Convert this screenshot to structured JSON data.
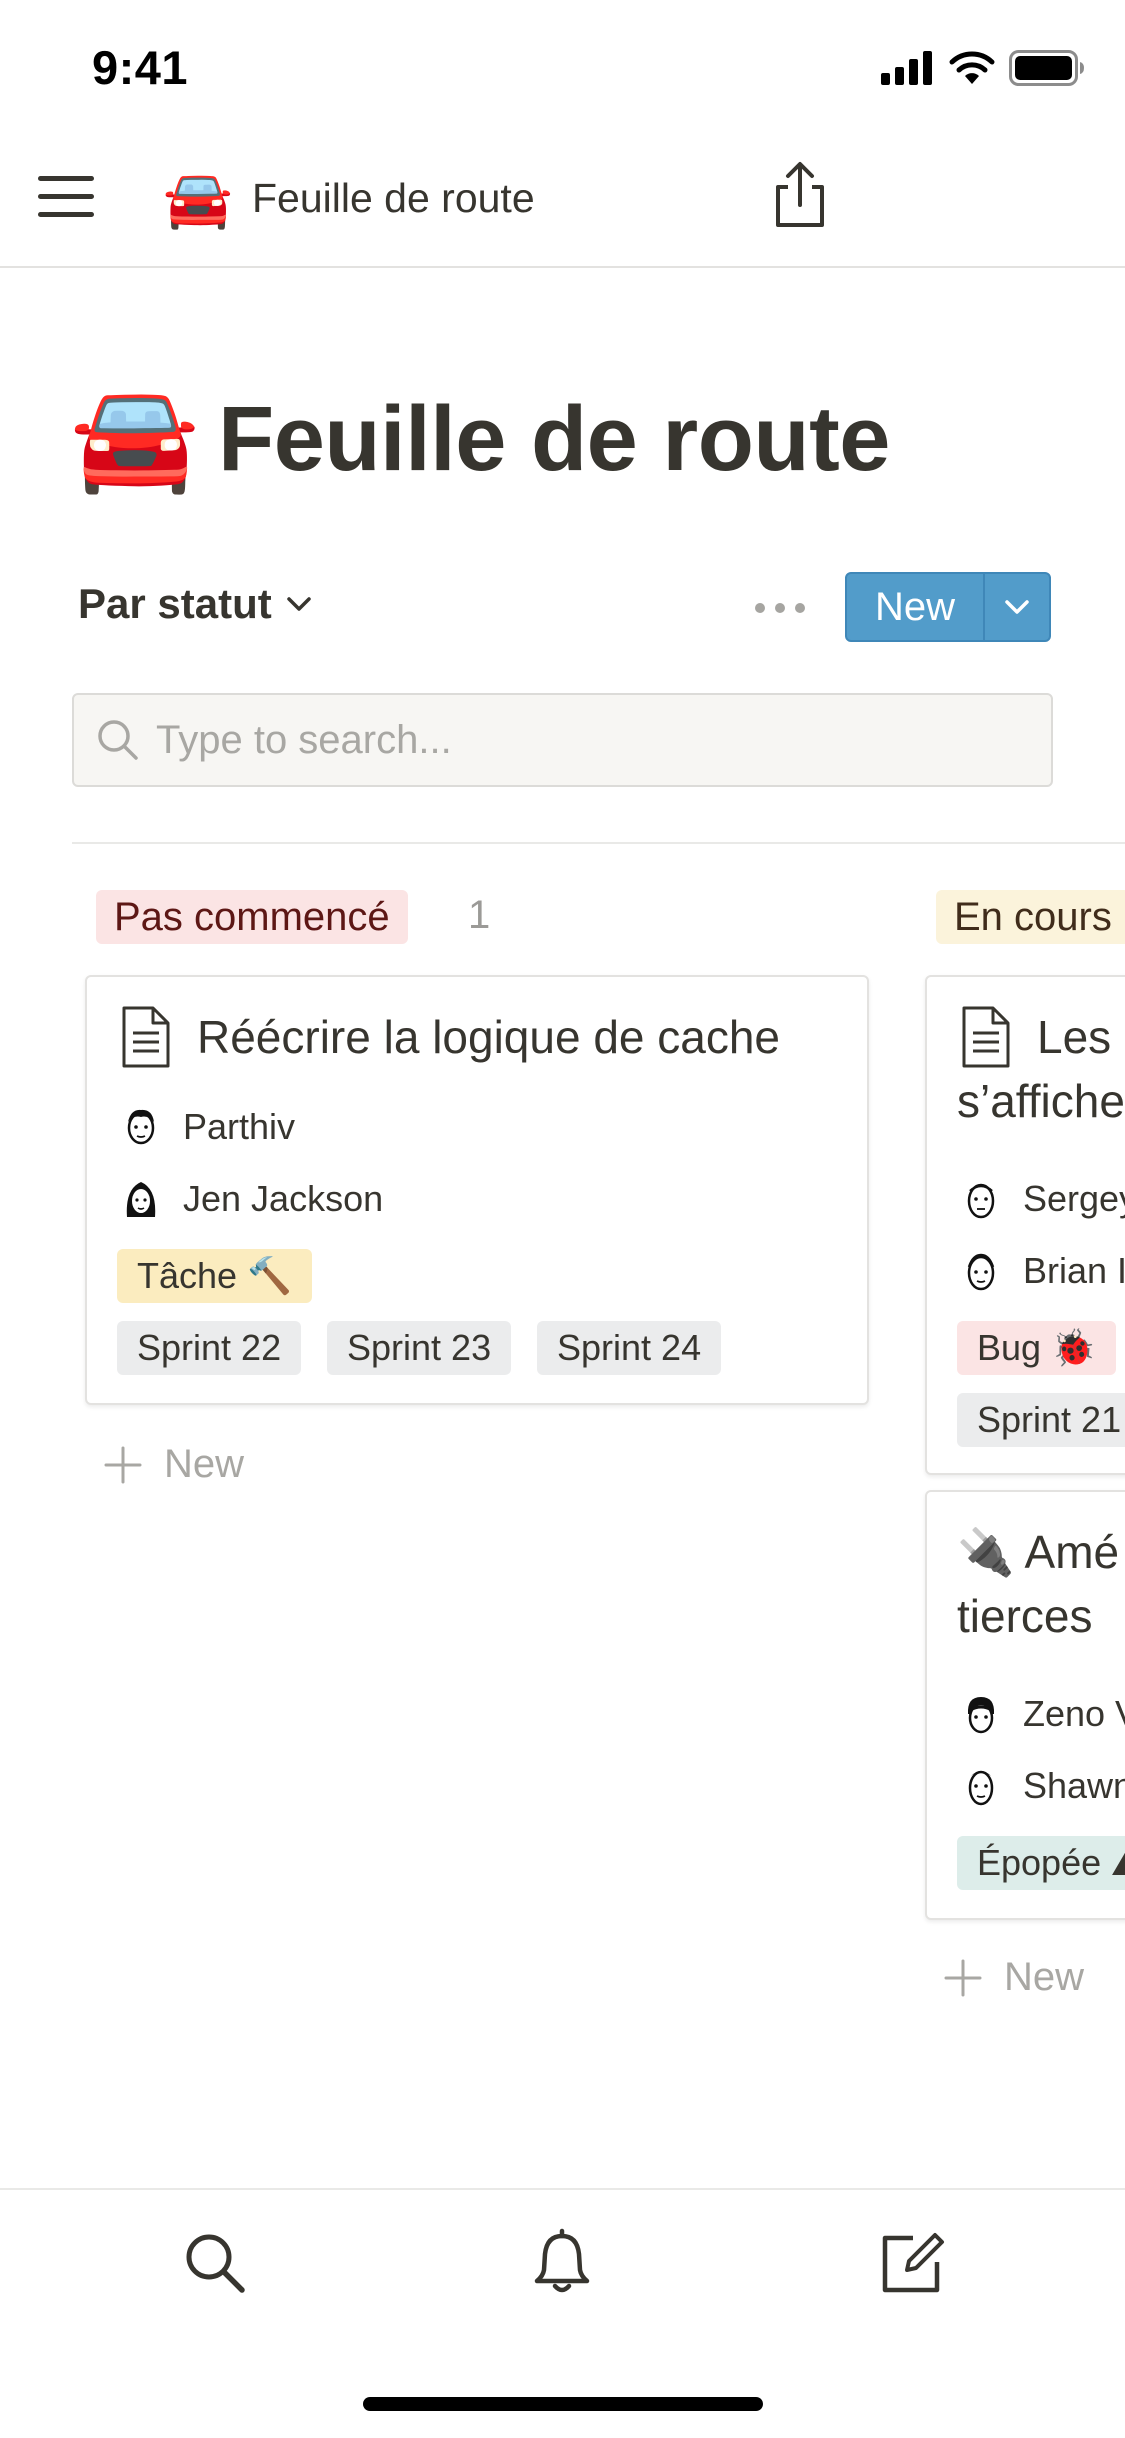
{
  "status_bar": {
    "time": "9:41"
  },
  "nav": {
    "emoji": "🚘",
    "title": "Feuille de route",
    "menu_icon": "hamburger-icon",
    "share_icon": "share-icon"
  },
  "page": {
    "emoji": "🚘",
    "title": "Feuille de route"
  },
  "toolbar": {
    "view_label": "Par statut",
    "new_label": "New"
  },
  "search": {
    "placeholder": "Type to search...",
    "value": ""
  },
  "columns": [
    {
      "label": "Pas commencé",
      "count": "1",
      "color": "#fbe4e4",
      "cards": [
        {
          "title": "Réécrire la logique de cache",
          "people": [
            "Parthiv",
            "Jen Jackson"
          ],
          "type_tag": "Tâche 🔨",
          "sprints": [
            "Sprint 22",
            "Sprint 23",
            "Sprint 24"
          ]
        }
      ],
      "add_label": "New"
    },
    {
      "label": "En cours",
      "color": "#fbf3db",
      "cards": [
        {
          "title_line1": "Les",
          "title_line2": "s’affiche",
          "people": [
            "Sergey",
            "Brian I"
          ],
          "type_tag": "Bug 🐞",
          "sprints": [
            "Sprint 21"
          ]
        },
        {
          "title_line1": "🔌 Amé",
          "title_line2": "tierces",
          "people": [
            "Zeno V",
            "Shawn"
          ],
          "type_tag": "Épopée ⛰"
        }
      ],
      "add_label": "New"
    }
  ],
  "tabbar": {
    "icons": [
      "search-icon",
      "bell-icon",
      "compose-icon"
    ]
  },
  "colors": {
    "accent": "#529cca",
    "text": "#37352f",
    "muted": "#a8a7a3"
  }
}
